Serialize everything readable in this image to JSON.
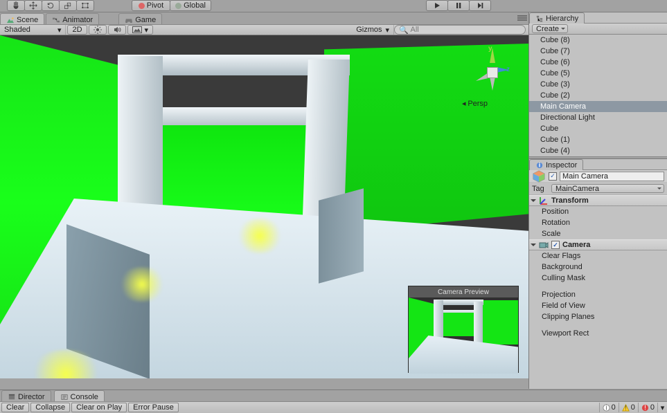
{
  "toolbar": {
    "pivot": "Pivot",
    "global": "Global"
  },
  "tabs": {
    "scene": "Scene",
    "animator": "Animator",
    "game": "Game",
    "director": "Director",
    "console": "Console",
    "hierarchy": "Hierarchy",
    "inspector": "Inspector"
  },
  "scene_toolbar": {
    "shading": "Shaded",
    "mode2d": "2D",
    "gizmos": "Gizmos",
    "search_placeholder": "All"
  },
  "gizmo": {
    "y": "y",
    "z": "z",
    "persp_label": "Persp"
  },
  "camera_preview_label": "Camera Preview",
  "hierarchy": {
    "create": "Create",
    "items": [
      "Cube (8)",
      "Cube (7)",
      "Cube (6)",
      "Cube (5)",
      "Cube (3)",
      "Cube (2)",
      "Main Camera",
      "Directional Light",
      "Cube",
      "Cube (1)",
      "Cube (4)"
    ],
    "selected_index": 6
  },
  "inspector": {
    "name": "Main Camera",
    "enabled": true,
    "tag_label": "Tag",
    "tag_value": "MainCamera",
    "transform": {
      "title": "Transform",
      "props": [
        "Position",
        "Rotation",
        "Scale"
      ]
    },
    "camera": {
      "title": "Camera",
      "props": [
        "Clear Flags",
        "Background",
        "Culling Mask",
        "",
        "Projection",
        "Field of View",
        "Clipping Planes",
        "",
        "Viewport Rect"
      ]
    }
  },
  "console": {
    "clear": "Clear",
    "collapse": "Collapse",
    "clear_on_play": "Clear on Play",
    "error_pause": "Error Pause",
    "info_count": "0",
    "warn_count": "0",
    "error_count": "0"
  }
}
